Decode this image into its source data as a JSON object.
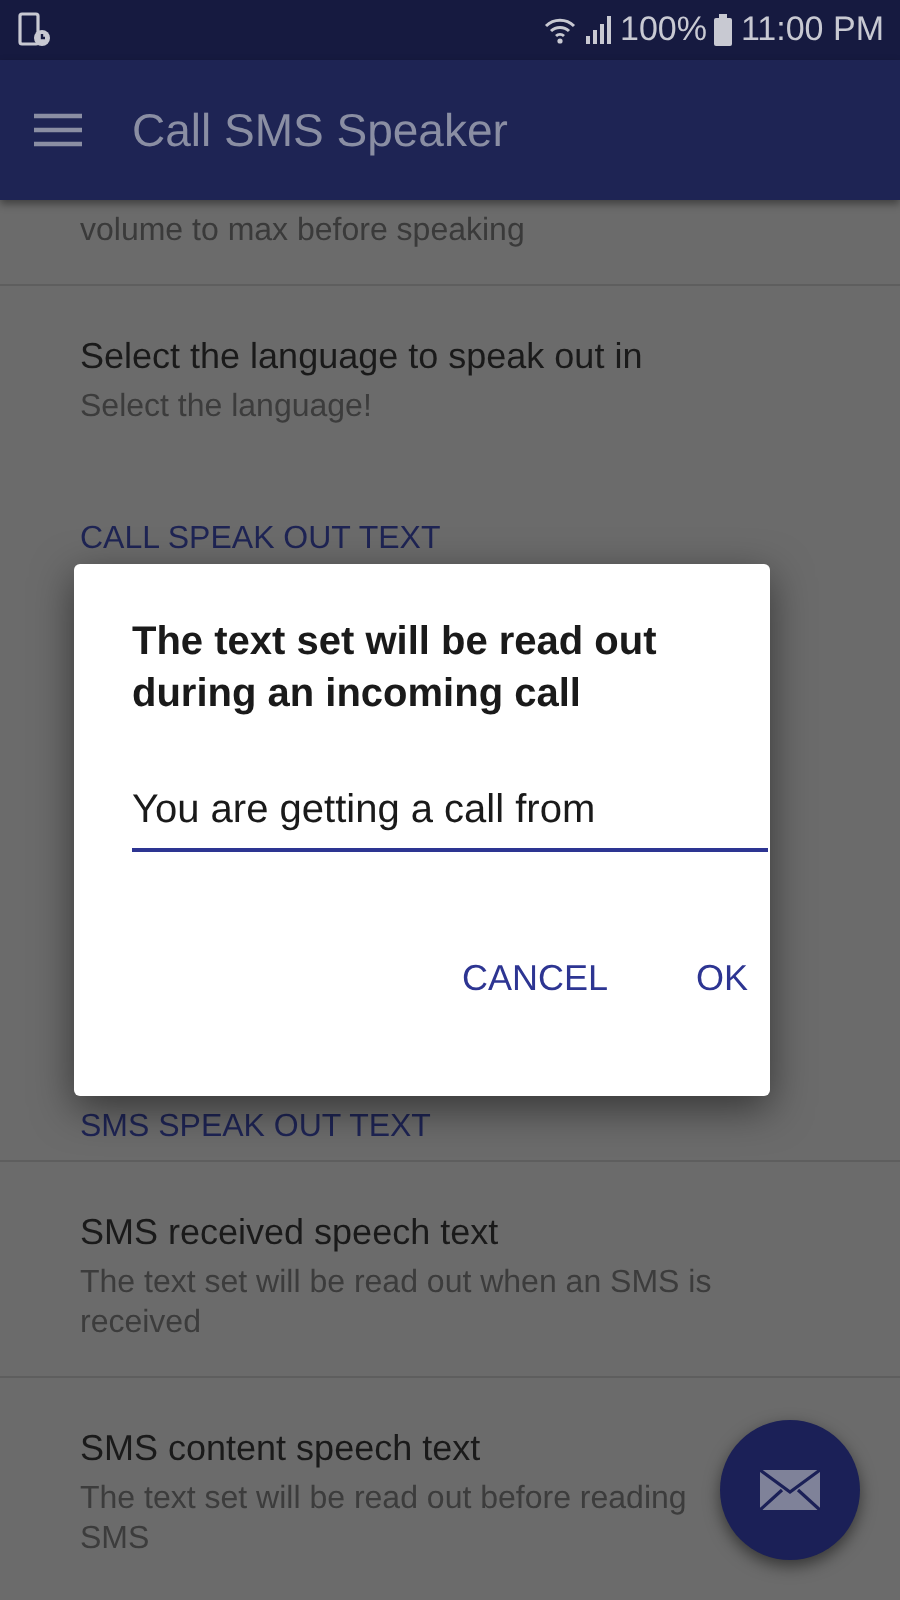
{
  "status_bar": {
    "battery": "100%",
    "time": "11:00 PM"
  },
  "app_bar": {
    "title": "Call SMS Speaker"
  },
  "settings": [
    {
      "kind": "fragment",
      "text": "volume to max before speaking"
    },
    {
      "kind": "preference",
      "title": "Select the language to speak out in",
      "summary": "Select the language!"
    },
    {
      "kind": "category",
      "title": "CALL SPEAK OUT TEXT"
    },
    {
      "kind": "category",
      "title": "SMS SPEAK OUT TEXT"
    },
    {
      "kind": "preference",
      "title": "SMS received speech text",
      "summary": "The text set will be read out when an SMS is received"
    },
    {
      "kind": "preference",
      "title": "SMS content speech text",
      "summary": "The text set will be read out before reading SMS"
    }
  ],
  "dialog": {
    "title": "The text set will be read out during an incoming call",
    "value": "You are getting a call from ",
    "buttons": [
      "CANCEL",
      "OK"
    ]
  }
}
